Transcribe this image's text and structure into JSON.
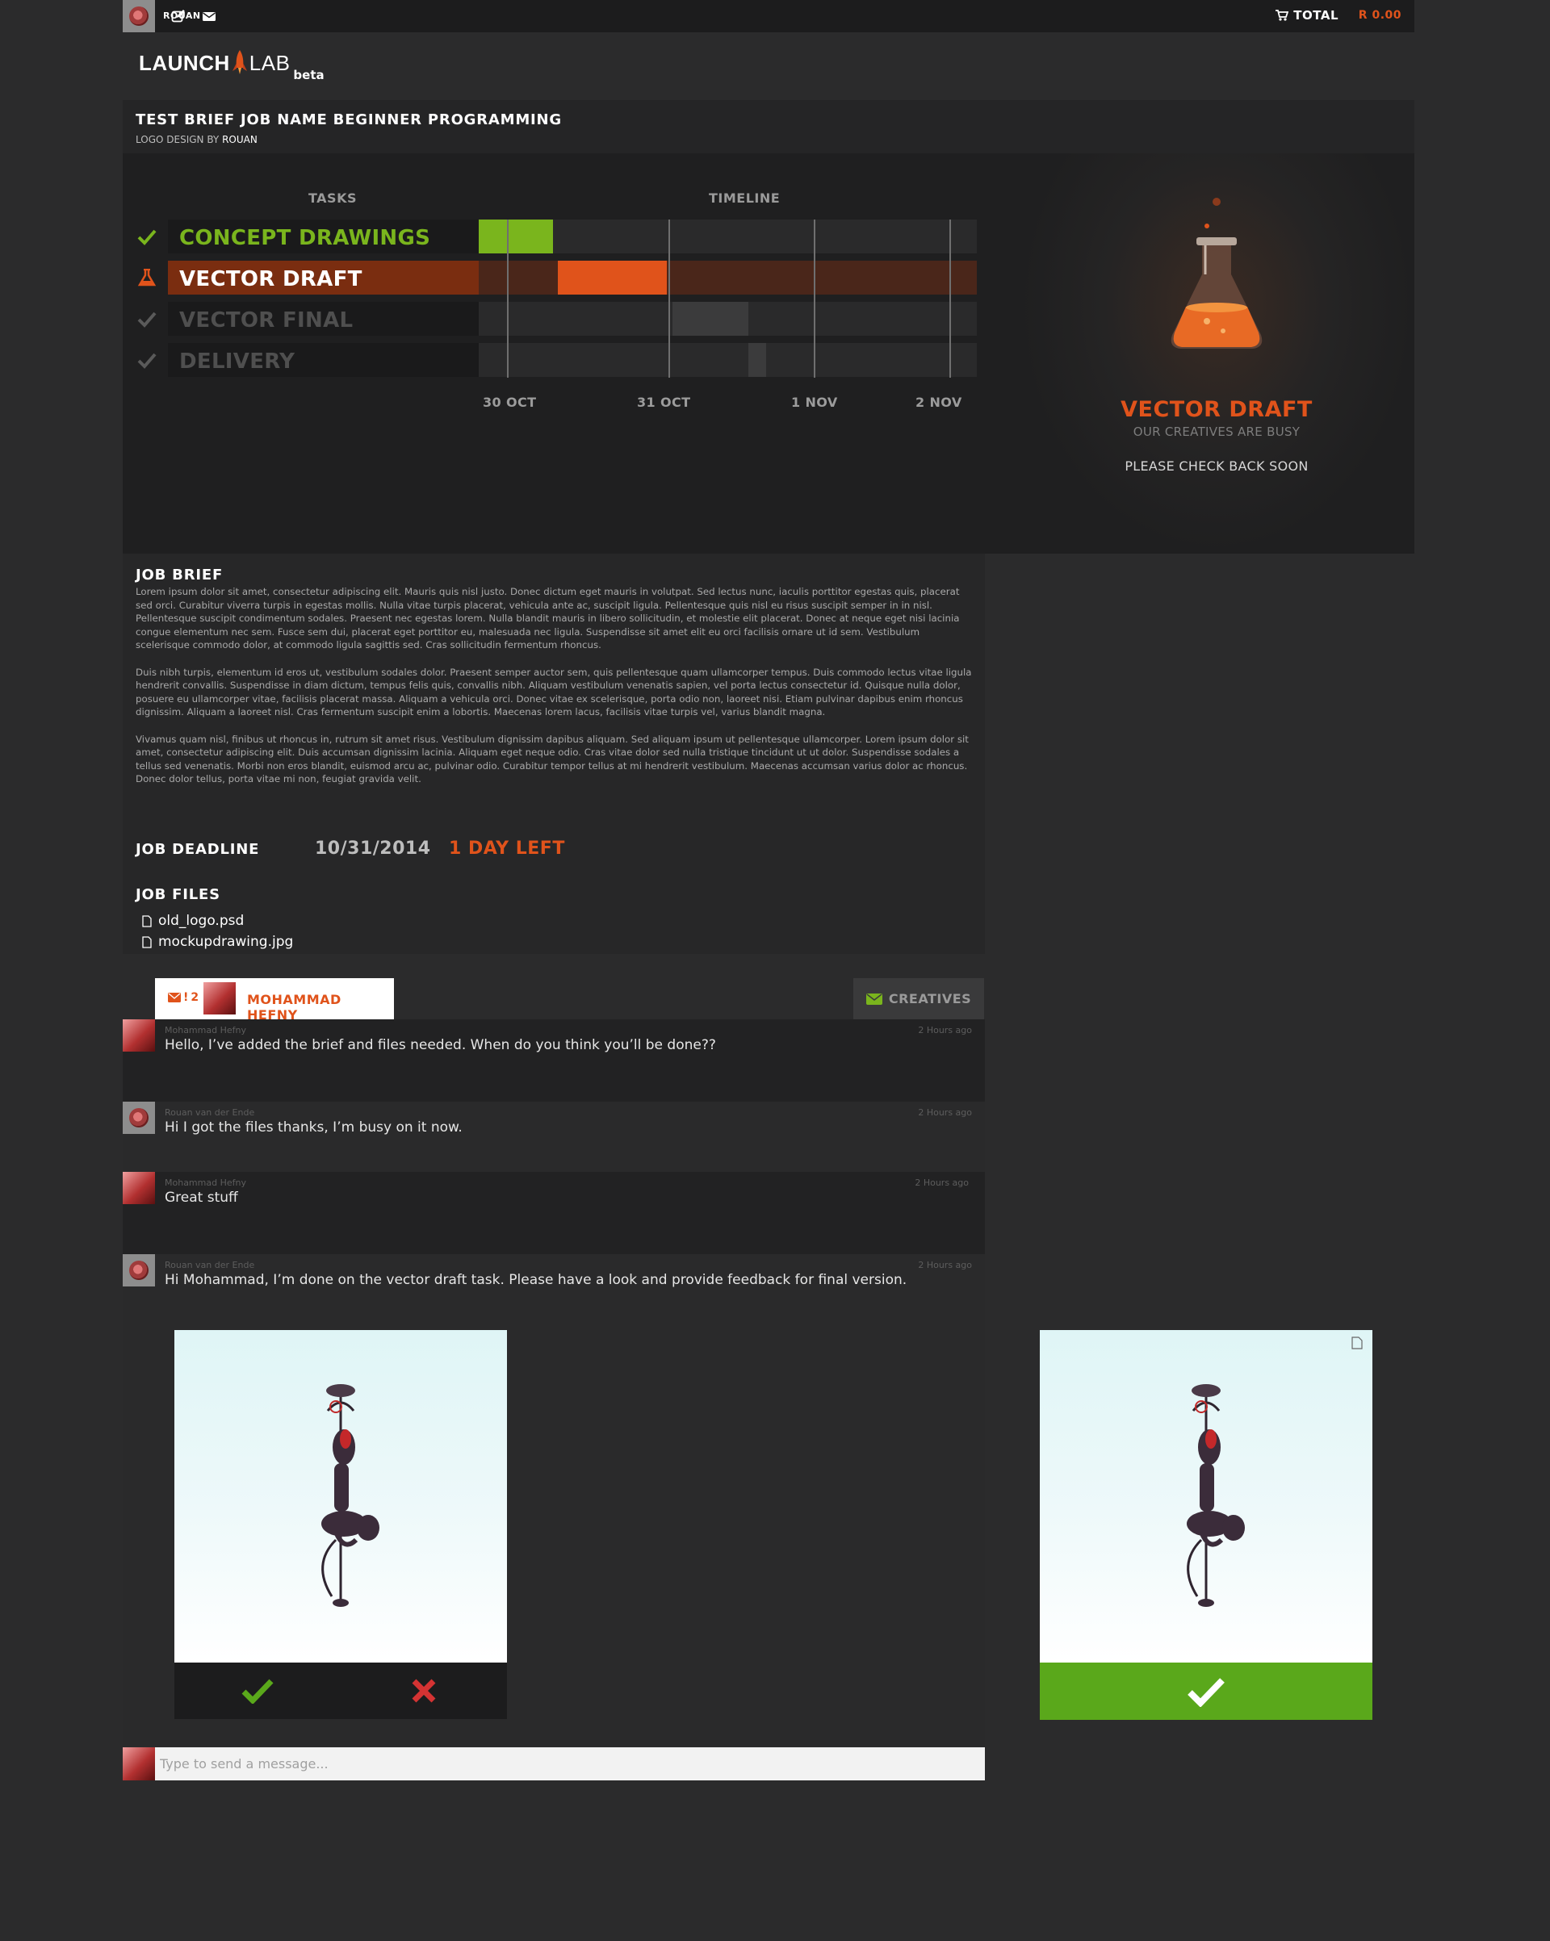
{
  "topbar": {
    "username": "ROUAN",
    "total_label": "TOTAL",
    "total_amount": "R 0.00"
  },
  "logo": {
    "launch": "LAUNCH",
    "lab": "LAB",
    "beta": "beta"
  },
  "job": {
    "title": "TEST BRIEF JOB NAME BEGINNER PROGRAMMING",
    "category": "LOGO DESIGN",
    "by": "BY",
    "author": "ROUAN"
  },
  "progress": {
    "tasks_heading": "TASKS",
    "timeline_heading": "TIMELINE",
    "tasks": [
      {
        "label": "CONCEPT DRAWINGS",
        "state": "done",
        "color": "#7ab51d"
      },
      {
        "label": "VECTOR DRAFT",
        "state": "active",
        "color": "#e0531b"
      },
      {
        "label": "VECTOR FINAL",
        "state": "pending",
        "color": "#5a5a5a"
      },
      {
        "label": "DELIVERY",
        "state": "pending",
        "color": "#5a5a5a"
      }
    ],
    "dates": [
      "30 OCT",
      "31 OCT",
      "1 NOV",
      "2 NOV"
    ]
  },
  "status": {
    "title": "VECTOR DRAFT",
    "subtitle": "OUR CREATIVES ARE BUSY",
    "message": "PLEASE CHECK BACK SOON"
  },
  "brief": {
    "heading": "JOB BRIEF",
    "paragraphs": [
      "Lorem ipsum dolor sit amet, consectetur adipiscing elit. Mauris quis nisl justo. Donec dictum eget mauris in volutpat. Sed lectus nunc, iaculis porttitor egestas quis, placerat sed orci. Curabitur viverra turpis in egestas mollis. Nulla vitae turpis placerat, vehicula ante ac, suscipit ligula. Pellentesque quis nisl eu risus suscipit semper in in nisl. Pellentesque suscipit condimentum sodales. Praesent nec egestas lorem. Nulla blandit mauris in libero sollicitudin, et molestie elit placerat. Donec at neque eget nisi lacinia congue elementum nec sem. Fusce sem dui, placerat eget porttitor eu, malesuada nec ligula. Suspendisse sit amet elit eu orci facilisis ornare ut id sem. Vestibulum scelerisque commodo dolor, at commodo ligula sagittis sed. Cras sollicitudin fermentum rhoncus.",
      "Duis nibh turpis, elementum id eros ut, vestibulum sodales dolor. Praesent semper auctor sem, quis pellentesque quam ullamcorper tempus. Duis commodo lectus vitae ligula hendrerit convallis. Suspendisse in diam dictum, tempus felis quis, convallis nibh. Aliquam vestibulum venenatis sapien, vel porta lectus consectetur id. Quisque nulla dolor, posuere eu ullamcorper vitae, facilisis placerat massa. Aliquam a vehicula orci. Donec vitae ex scelerisque, porta odio non, laoreet nisi. Etiam pulvinar dapibus enim rhoncus dignissim. Aliquam a laoreet nisl. Cras fermentum suscipit enim a lobortis. Maecenas lorem lacus, facilisis vitae turpis vel, varius blandit magna.",
      "Vivamus quam nisl, finibus ut rhoncus in, rutrum sit amet risus. Vestibulum dignissim dapibus aliquam. Sed aliquam ipsum ut pellentesque ullamcorper. Lorem ipsum dolor sit amet, consectetur adipiscing elit. Duis accumsan dignissim lacinia. Aliquam eget neque odio. Cras vitae dolor sed nulla tristique tincidunt ut ut dolor. Suspendisse sodales a tellus sed venenatis. Morbi non eros blandit, euismod arcu ac, pulvinar odio. Curabitur tempor tellus at mi hendrerit vestibulum. Maecenas accumsan varius dolor ac rhoncus. Donec dolor tellus, porta vitae mi non, feugiat gravida velit."
    ],
    "deadline_label": "JOB DEADLINE",
    "deadline_date": "10/31/2014",
    "deadline_left": "1 DAY LEFT",
    "files_heading": "JOB FILES",
    "files": [
      "old_logo.psd",
      "mockupdrawing.jpg"
    ]
  },
  "chat": {
    "tab_unread": "2",
    "tab_name": "MOHAMMAD HEFNY",
    "creatives_label": "CREATIVES",
    "messages": [
      {
        "name": "Mohammad Hefny",
        "time": "2 Hours ago",
        "text": "Hello, I’ve added the brief and files needed. When do you think you’ll be done??"
      },
      {
        "name": "Rouan van der Ende",
        "time": "2 Hours ago",
        "text": "Hi I got the files thanks, I’m busy on it now."
      },
      {
        "name": "Mohammad Hefny",
        "time": "2 Hours ago",
        "text": "Great stuff"
      },
      {
        "name": "Rouan van der Ende",
        "time": "2 Hours ago",
        "text": "Hi Mohammad, I’m done on the vector draft task. Please have a look and provide feedback for final version."
      }
    ],
    "input_placeholder": "Type to send a message..."
  },
  "colors": {
    "accent_orange": "#e0531b",
    "accent_green": "#7ab51d",
    "approve_green": "#5aa81b",
    "reject_red": "#d43333"
  }
}
